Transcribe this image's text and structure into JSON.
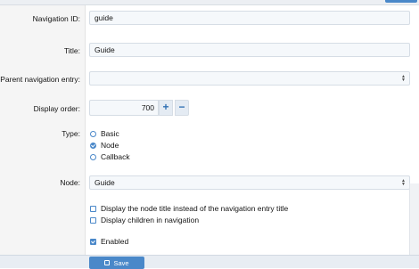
{
  "form": {
    "navigation_id": {
      "label": "Navigation ID:",
      "value": "guide"
    },
    "title": {
      "label": "Title:",
      "value": "Guide"
    },
    "parent": {
      "label": "Parent navigation entry:",
      "value": ""
    },
    "display_order": {
      "label": "Display order:",
      "value": "700",
      "plus": "+",
      "minus": "−"
    },
    "type": {
      "label": "Type:",
      "options": [
        {
          "label": "Basic",
          "selected": false
        },
        {
          "label": "Node",
          "selected": true
        },
        {
          "label": "Callback",
          "selected": false
        }
      ]
    },
    "node": {
      "label": "Node:",
      "value": "Guide"
    },
    "checkboxes": [
      {
        "label": "Display the node title instead of the navigation entry title",
        "checked": false
      },
      {
        "label": "Display children in navigation",
        "checked": false
      },
      {
        "label": "Enabled",
        "checked": true
      }
    ]
  },
  "footer": {
    "save_label": "Save"
  },
  "colors": {
    "accent": "#4a88c9",
    "label_bg": "#f5f5f5",
    "input_bg": "#f5f8fb"
  }
}
